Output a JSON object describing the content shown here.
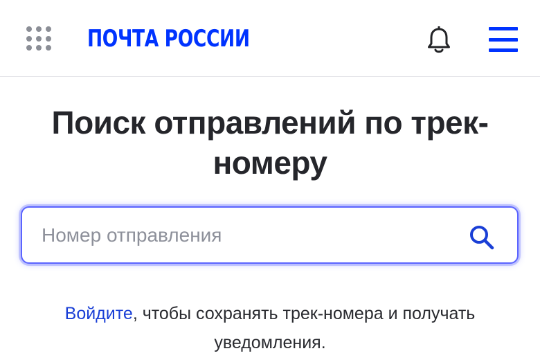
{
  "header": {
    "logo_text": "ПОЧТА РОССИИ",
    "apps_icon": "grid-dots-icon",
    "bell_icon": "bell-icon",
    "menu_icon": "hamburger-menu-icon"
  },
  "main": {
    "title_line1": "Поиск отправлений по трек-",
    "title_line2": "номеру"
  },
  "search": {
    "placeholder": "Номер отправления",
    "value": "",
    "icon": "search-icon"
  },
  "login_note": {
    "link_text": "Войдите",
    "text": ", чтобы сохранять трек-номера и получать уведомления."
  },
  "colors": {
    "brand": "#0033ff",
    "focus_ring": "#5b64ff",
    "link": "#1a3fd6",
    "text": "#222326",
    "placeholder": "#8d909a"
  }
}
